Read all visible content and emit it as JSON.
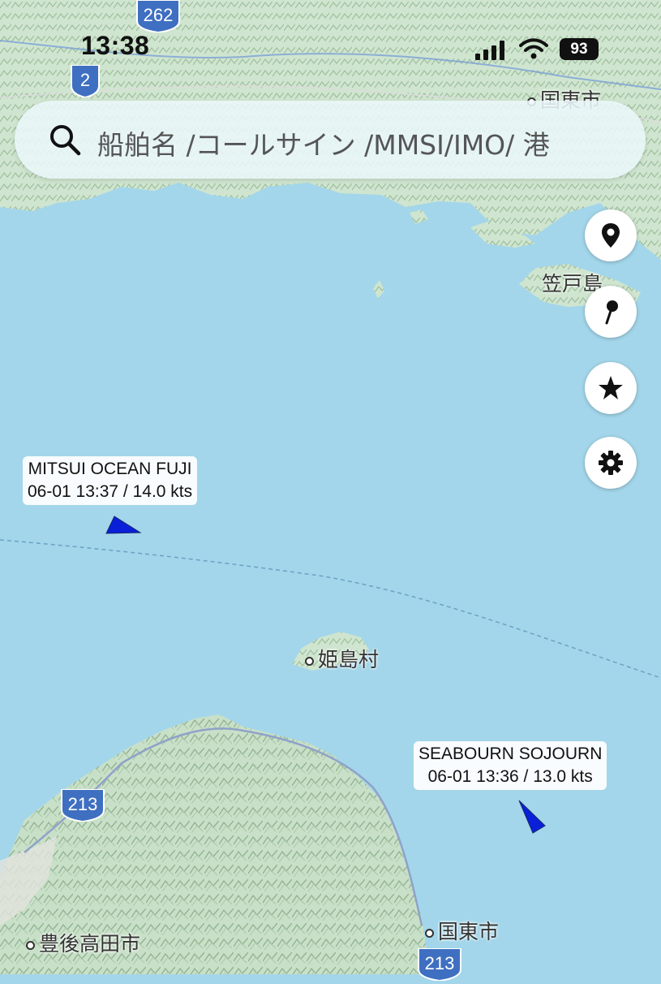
{
  "status_bar": {
    "time": "13:38",
    "battery": "93"
  },
  "search": {
    "placeholder": "船舶名 /コールサイン /MMSI/IMO/ 港"
  },
  "controls": [
    {
      "name": "location-button",
      "icon": "map-pin-icon"
    },
    {
      "name": "pin-button",
      "icon": "push-pin-icon"
    },
    {
      "name": "favorites-button",
      "icon": "star-icon"
    },
    {
      "name": "settings-button",
      "icon": "gear-icon"
    }
  ],
  "vessels": [
    {
      "name": "MITSUI OCEAN FUJI",
      "info": "06-01 13:37 / 14.0 kts",
      "color": "#0a1fd8"
    },
    {
      "name": "SEABOURN SOJOURN",
      "info": "06-01 13:36 / 13.0 kts",
      "color": "#0a1fd8"
    }
  ],
  "places": [
    {
      "name": "姫島村"
    },
    {
      "name": "豊後高田市"
    },
    {
      "name": "国東市"
    },
    {
      "name": "国東市"
    },
    {
      "name": "笠戸島"
    }
  ],
  "routes": [
    {
      "number": "262"
    },
    {
      "number": "2"
    },
    {
      "number": "213"
    },
    {
      "number": "213"
    }
  ],
  "colors": {
    "sea": "#a3d6ea",
    "land": "#d4e8d4",
    "route_shield": "#3e6fc1"
  }
}
